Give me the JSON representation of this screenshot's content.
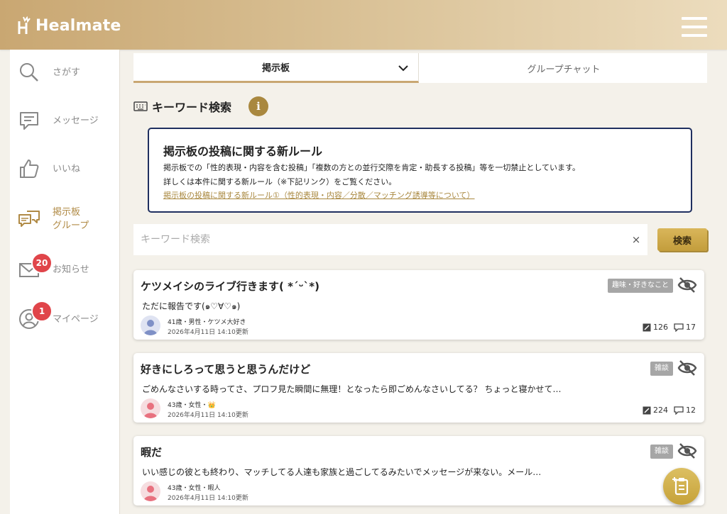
{
  "header": {
    "app_name": "Healmate"
  },
  "sidebar": {
    "items": [
      {
        "label": "さがす",
        "icon": "search-icon"
      },
      {
        "label": "メッセージ",
        "icon": "message-icon"
      },
      {
        "label": "いいね",
        "icon": "thumbs-up-icon"
      },
      {
        "label": "掲示板",
        "label2": "グループ",
        "icon": "board-icon",
        "active": true
      },
      {
        "label": "お知らせ",
        "icon": "mail-icon",
        "badge": "20"
      },
      {
        "label": "マイページ",
        "icon": "user-icon",
        "badge": "1"
      }
    ]
  },
  "tabs": {
    "board": "掲示板",
    "group_chat": "グループチャット"
  },
  "keyword_section": {
    "title": "キーワード検索"
  },
  "rules": {
    "title": "掲示板の投稿に関する新ルール",
    "line1": "掲示板での「性的表現・内容を含む投稿」「複数の方との並行交際を肯定・助長する投稿」等を一切禁止としています。",
    "line2": "詳しくは本件に関する新ルール（※下記リンク）をご覧ください。",
    "link": "掲示板の投稿に関する新ルール①（性的表現・内容／分散／マッチング誘導等について）"
  },
  "search": {
    "placeholder": "キーワード検索",
    "value": "",
    "button": "検索",
    "clear": "×"
  },
  "posts": [
    {
      "title": "ケツメイシのライブ行きます( *ˊᵕˋ*)",
      "category": "趣味・好きなこと",
      "body": "ただに報告です(๑♡∀♡๑)",
      "author": "41歳・男性・ケツメ大好き",
      "updated": "2026年4月11日 14:10更新",
      "views": "126",
      "comments": "17",
      "avatar_color": "#7f90c6"
    },
    {
      "title": "好きにしろって思うと思うんだけど",
      "category": "雑談",
      "body": "ごめんなさいする時ってさ、プロフ見た瞬間に無理！となったら即ごめんなさいしてる？ ちょっと寝かせて…",
      "author": "43歳・女性・👑",
      "updated": "2026年4月11日 14:10更新",
      "views": "224",
      "comments": "12",
      "avatar_color": "#e8717f"
    },
    {
      "title": "暇だ",
      "category": "雑談",
      "body": "いい感じの彼とも終わり、マッチしてる人達も家族と過ごしてるみたいでメッセージが来ない。メール…",
      "author": "43歳・女性・暇人",
      "updated": "2026年4月11日 14:10更新",
      "views": "",
      "comments": "",
      "avatar_color": "#e8717f"
    }
  ],
  "colors": {
    "accent": "#c9a772",
    "gold_button": "#d9b65a",
    "badge_red": "#e0454a",
    "rule_border": "#1f2f5f"
  }
}
